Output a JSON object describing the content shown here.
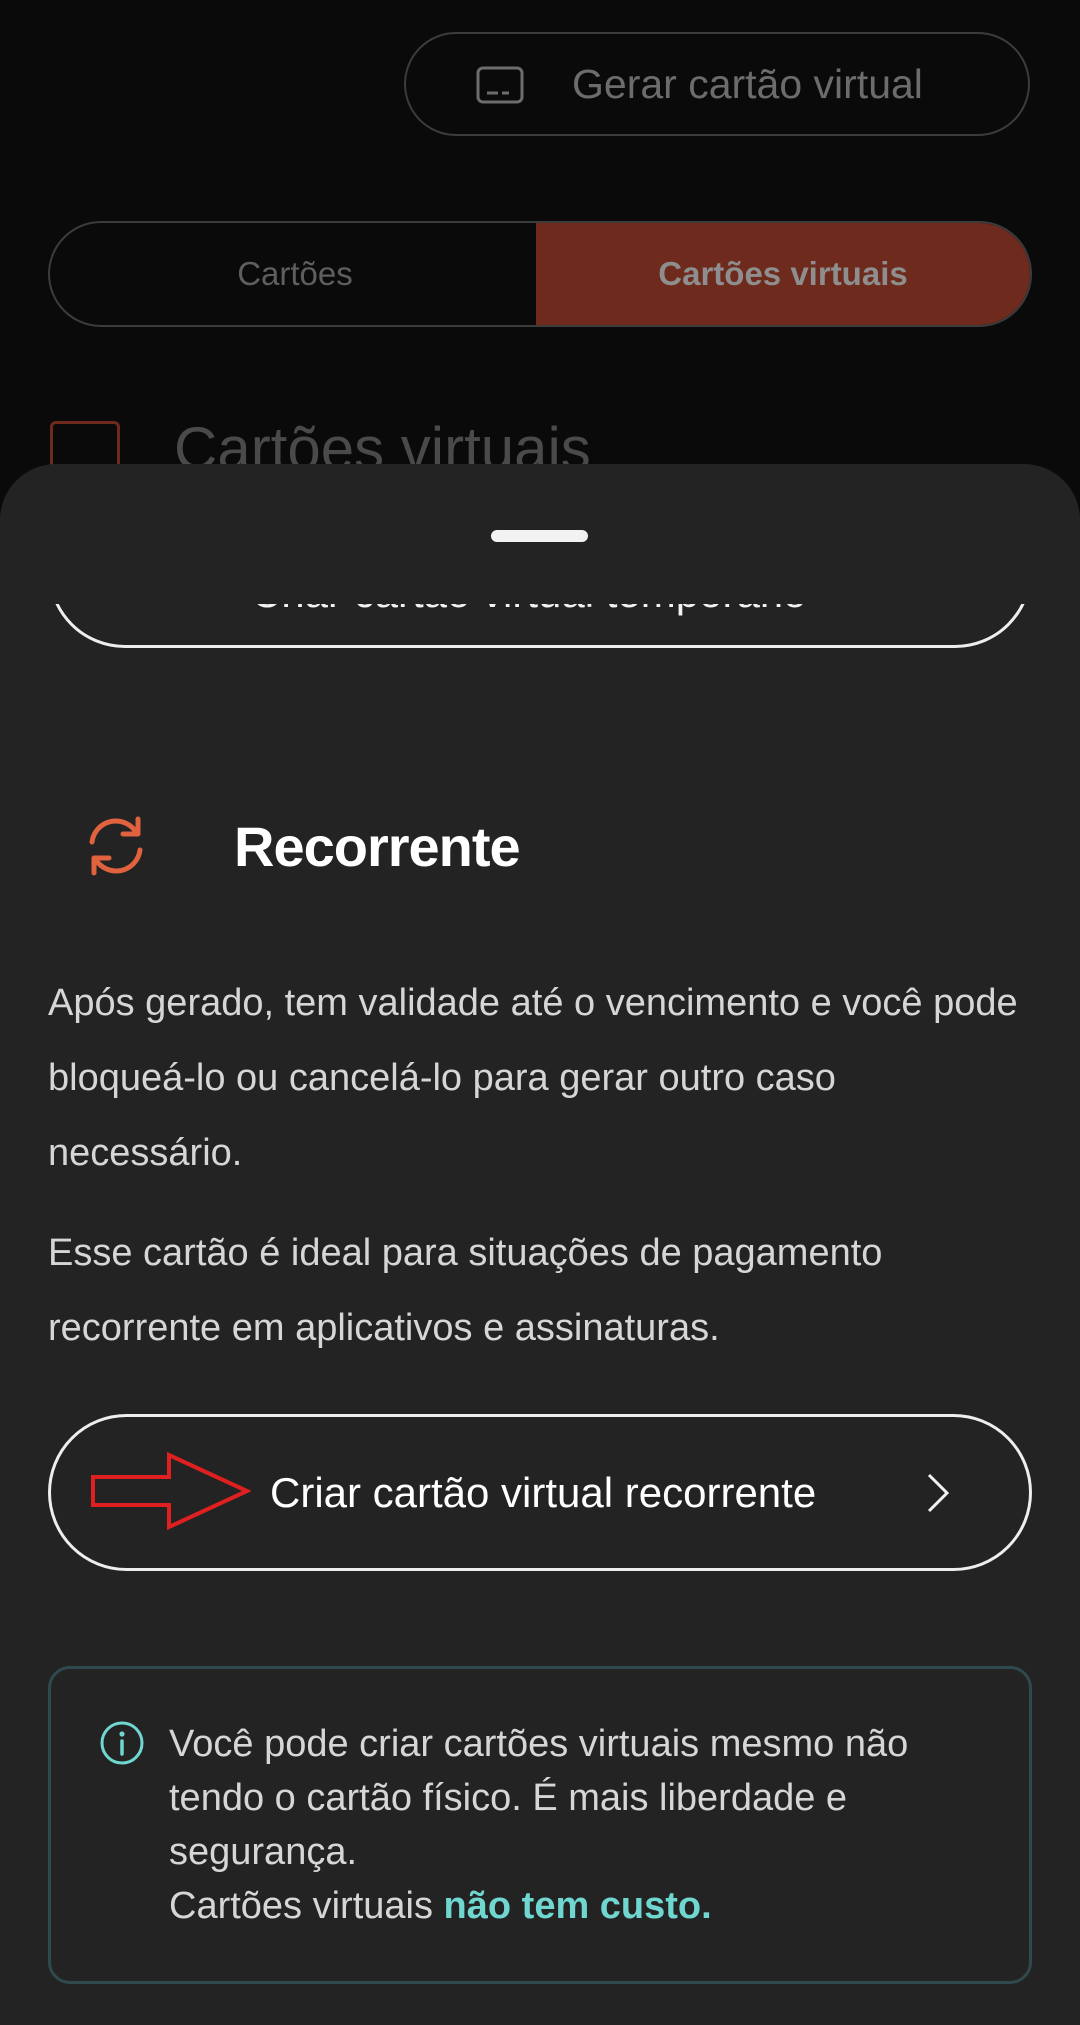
{
  "background": {
    "generate_button_label": "Gerar cartão virtual",
    "tabs": {
      "cards": "Cartões",
      "virtual_cards": "Cartões virtuais",
      "active": "virtual_cards"
    },
    "section_title": "Cartões virtuais"
  },
  "sheet": {
    "temporary_button_label": "Criar cartão virtual temporário",
    "recurring": {
      "title": "Recorrente",
      "paragraph_1": "Após gerado, tem validade até o vencimento e você pode bloqueá-lo ou cancelá-lo para gerar outro caso necessário.",
      "paragraph_2": "Esse cartão é ideal para situações de pagamento recorrente em aplicativos e assinaturas.",
      "button_label": "Criar cartão virtual recorrente"
    },
    "info": {
      "text": "Você pode criar cartões virtuais mesmo não tendo o cartão físico. É mais liberdade e segurança.",
      "footer_prefix": "Cartões virtuais ",
      "footer_highlight": "não tem custo."
    }
  },
  "icons": [
    "card-icon",
    "refresh-icon",
    "chevron-right-icon",
    "info-icon",
    "annotation-arrow"
  ],
  "colors": {
    "accent": "#e0623f",
    "tab_active": "#6e2a1c",
    "info_highlight": "#6fd6d0",
    "annotation": "#e02020"
  }
}
